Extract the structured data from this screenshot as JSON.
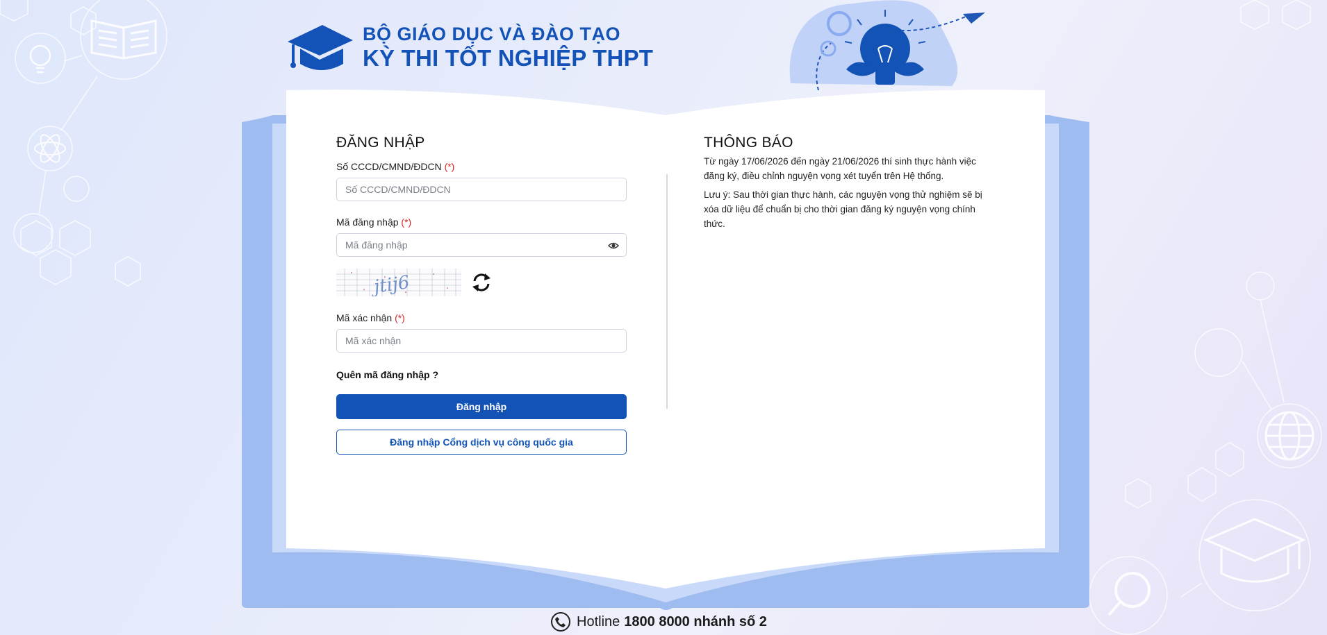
{
  "header": {
    "line1": "BỘ GIÁO DỤC VÀ ĐÀO TẠO",
    "line2": "KỲ THI TỐT NGHIỆP THPT"
  },
  "login": {
    "title": "ĐĂNG NHẬP",
    "id_label": "Số CCCD/CMND/ĐDCN",
    "id_placeholder": "Số CCCD/CMND/ĐDCN",
    "password_label": "Mã đăng nhập",
    "password_placeholder": "Mã đăng nhập",
    "captcha_text": "jtij6",
    "captcha_label": "Mã xác nhận",
    "captcha_placeholder": "Mã xác nhận",
    "required_mark": "(*)",
    "forgot": "Quên mã đăng nhập ?",
    "submit": "Đăng nhập",
    "national_portal": "Đăng nhập Cổng dịch vụ công quốc gia"
  },
  "notice": {
    "title": "THÔNG BÁO",
    "paragraph1": "Từ ngày 17/06/2026 đến ngày 21/06/2026 thí sinh thực hành việc đăng ký, điều chỉnh nguyện vọng xét tuyển trên Hệ thống.",
    "paragraph2": "Lưu ý: Sau thời gian thực hành, các nguyện vọng thử nghiệm sẽ bị xóa dữ liệu để chuẩn bị cho thời gian đăng ký nguyện vọng chính thức."
  },
  "hotline": {
    "prefix": "Hotline",
    "number": "1800 8000 nhánh số 2"
  },
  "colors": {
    "brand": "#1353b8",
    "required": "#d62828",
    "book_blue": "#a5c2f1"
  },
  "icons": {
    "logo": "graduation-cap-icon",
    "eye": "eye-icon",
    "refresh": "refresh-icon",
    "phone": "phone-icon",
    "lightbulb": "lightbulb-icon"
  }
}
